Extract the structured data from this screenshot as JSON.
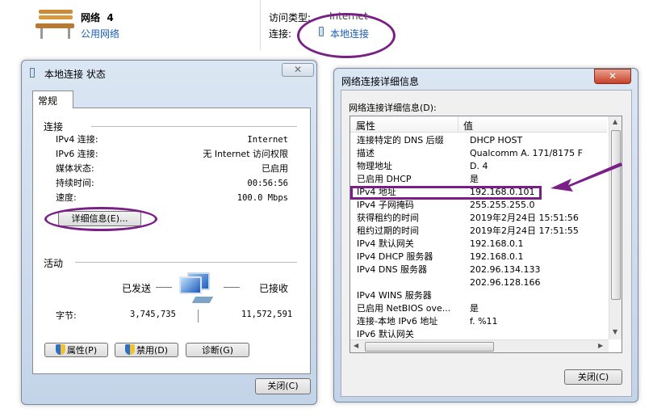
{
  "network": {
    "name": "网络  4",
    "type_link": "公用网络",
    "access_label": "访问类型:",
    "access_value": "Internet",
    "conn_label": "连接:",
    "conn_link": "本地连接"
  },
  "status_dialog": {
    "title": "本地连接 状态",
    "tab": "常规",
    "conn_section": "连接",
    "rows": [
      {
        "k": "IPv4 连接:",
        "v": "Internet"
      },
      {
        "k": "IPv6 连接:",
        "v": "无 Internet 访问权限"
      },
      {
        "k": "媒体状态:",
        "v": "已启用"
      },
      {
        "k": "持续时间:",
        "v": "00:56:56"
      },
      {
        "k": "速度:",
        "v": "100.0 Mbps"
      }
    ],
    "details_btn": "详细信息(E)...",
    "activity_section": "活动",
    "sent": "已发送",
    "received": "已接收",
    "bytes_label": "字节:",
    "bytes_sent": "3,745,735",
    "bytes_received": "11,572,591",
    "props_btn": "属性(P)",
    "disable_btn": "禁用(D)",
    "diagnose_btn": "诊断(G)",
    "close_btn": "关闭(C)"
  },
  "details_dialog": {
    "title": "网络连接详细信息",
    "list_label": "网络连接详细信息(D):",
    "col_prop": "属性",
    "col_value": "值",
    "rows": [
      {
        "k": "连接特定的 DNS 后缀",
        "v": "DHCP HOST"
      },
      {
        "k": "描述",
        "v": "Qualcomm A.          171/8175 F"
      },
      {
        "k": "物理地址",
        "v": "D.                 4"
      },
      {
        "k": "已启用 DHCP",
        "v": "是"
      },
      {
        "k": "IPv4 地址",
        "v": "192.168.0.101"
      },
      {
        "k": "IPv4 子网掩码",
        "v": "255.255.255.0"
      },
      {
        "k": "获得租约的时间",
        "v": "2019年2月24日 15:51:56"
      },
      {
        "k": "租约过期的时间",
        "v": "2019年2月24日 17:51:55"
      },
      {
        "k": "IPv4 默认网关",
        "v": "192.168.0.1"
      },
      {
        "k": "IPv4 DHCP 服务器",
        "v": "192.168.0.1"
      },
      {
        "k": "IPv4 DNS 服务器",
        "v": "202.96.134.133"
      },
      {
        "k": "",
        "v": "202.96.128.166"
      },
      {
        "k": "IPv4 WINS 服务器",
        "v": ""
      },
      {
        "k": "已启用 NetBIOS ove...",
        "v": "是"
      },
      {
        "k": "连接-本地 IPv6 地址",
        "v": "f.                    %11"
      },
      {
        "k": "IPv6 默认网关",
        "v": ""
      }
    ],
    "close_btn": "关闭(C)"
  },
  "colors": {
    "annotation": "#7a1f86",
    "link": "#1a5fb4"
  }
}
